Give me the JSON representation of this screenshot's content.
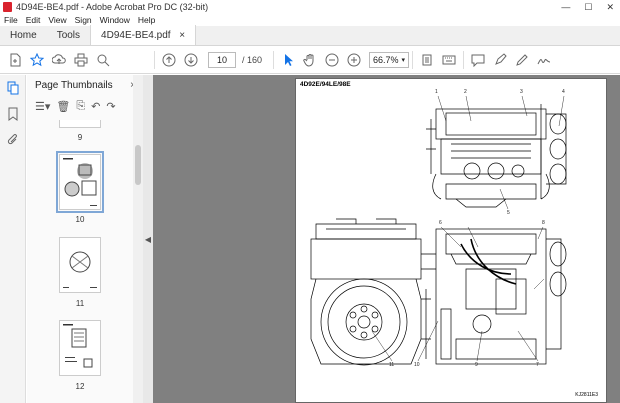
{
  "window": {
    "title": "4D94E-BE4.pdf - Adobe Acrobat Pro DC (32-bit)",
    "controls": [
      "—",
      "☐",
      "✕"
    ]
  },
  "menu": [
    "File",
    "Edit",
    "View",
    "Sign",
    "Window",
    "Help"
  ],
  "tabs": {
    "home": "Home",
    "tools": "Tools",
    "document": "4D94E-BE4.pdf",
    "close": "×"
  },
  "toolbar": {
    "page_current": "10",
    "page_total": "/ 160",
    "zoom": "66.7%"
  },
  "panel": {
    "title": "Page Thumbnails",
    "close": "×"
  },
  "thumbnails": [
    {
      "label": "9"
    },
    {
      "label": "10"
    },
    {
      "label": "11"
    },
    {
      "label": "12"
    }
  ],
  "document": {
    "header": "4D92E/94LE/98E",
    "footer": "KJ2811E3",
    "callouts": [
      "1",
      "2",
      "3",
      "4",
      "5",
      "6",
      "7",
      "8",
      "9",
      "10",
      "11"
    ]
  }
}
